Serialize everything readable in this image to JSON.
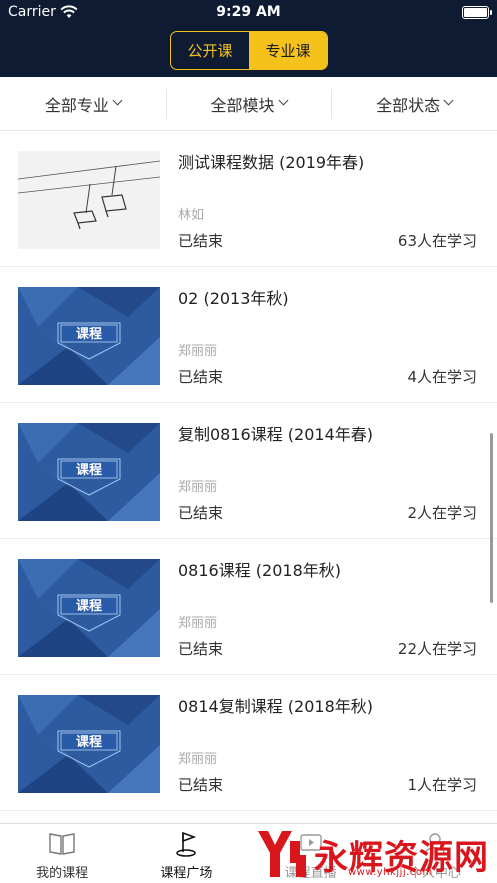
{
  "status_bar": {
    "carrier": "Carrier",
    "time": "9:29 AM"
  },
  "segment": {
    "options": [
      "公开课",
      "专业课"
    ],
    "selected": "专业课"
  },
  "filters": [
    "全部专业",
    "全部模块",
    "全部状态"
  ],
  "courses": [
    {
      "title": "测试课程数据 (2019年春)",
      "teacher": "林如",
      "status": "已结束",
      "learners": "63人在学习",
      "thumb": "photo-ski-lift",
      "thumb_text": ""
    },
    {
      "title": "02 (2013年秋)",
      "teacher": "郑丽丽",
      "status": "已结束",
      "learners": "4人在学习",
      "thumb": "course-cover",
      "thumb_text": "课程"
    },
    {
      "title": "复制0816课程 (2014年春)",
      "teacher": "郑丽丽",
      "status": "已结束",
      "learners": "2人在学习",
      "thumb": "course-cover",
      "thumb_text": "课程"
    },
    {
      "title": "0816课程 (2018年秋)",
      "teacher": "郑丽丽",
      "status": "已结束",
      "learners": "22人在学习",
      "thumb": "course-cover",
      "thumb_text": "课程"
    },
    {
      "title": "0814复制课程 (2018年秋)",
      "teacher": "郑丽丽",
      "status": "已结束",
      "learners": "1人在学习",
      "thumb": "course-cover",
      "thumb_text": "课程"
    }
  ],
  "tabbar": [
    {
      "label": "我的课程",
      "icon": "book-icon"
    },
    {
      "label": "课程广场",
      "icon": "flag-icon",
      "active": true
    },
    {
      "label": "课程直播",
      "icon": "live-icon"
    },
    {
      "label": "个人中心",
      "icon": "person-icon"
    }
  ],
  "watermark": {
    "text": "永辉资源网",
    "url": "www.yhkjjj.com"
  },
  "colors": {
    "header_bg": "#0f1b33",
    "accent": "#f5c21b",
    "watermark": "#d9161c"
  }
}
